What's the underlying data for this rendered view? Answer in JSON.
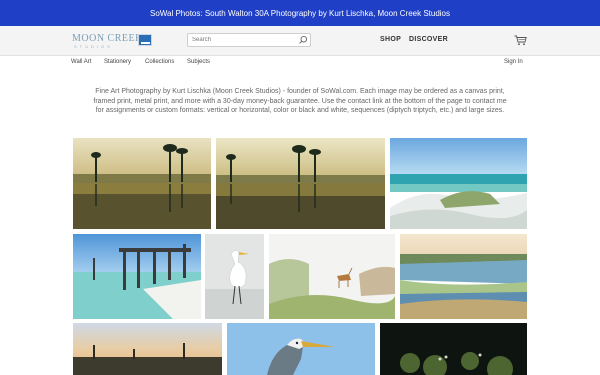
{
  "banner": {
    "text": "SoWal Photos: South Walton 30A Photography by Kurt Lischka, Moon Creek Studios"
  },
  "header": {
    "logo_text": "MOON CREEK",
    "logo_sub": "STUDIOS",
    "search_placeholder": "Search",
    "shop_label": "SHOP",
    "discover_label": "DISCOVER"
  },
  "subnav": {
    "items": [
      "Wall Art",
      "Stationery",
      "Collections",
      "Subjects"
    ],
    "sign_in": "Sign In"
  },
  "intro": {
    "text": "Fine Art Photography by Kurt Lischka (Moon Creek Studios) - founder of SoWal.com. Each image may be ordered as a canvas print, framed print, metal print, and more with a 30-day money-back guarantee. Use the contact link at the bottom of the page to contact me for assignments or custom formats: vertical or horizontal, color or black and white, sequences (diptych triptych, etc.) and large sizes."
  },
  "colors": {
    "banner_bg": "#1f3fc6",
    "header_bg": "#f4f4f4"
  },
  "icons": {
    "search": "search-icon",
    "cart": "cart-icon"
  }
}
